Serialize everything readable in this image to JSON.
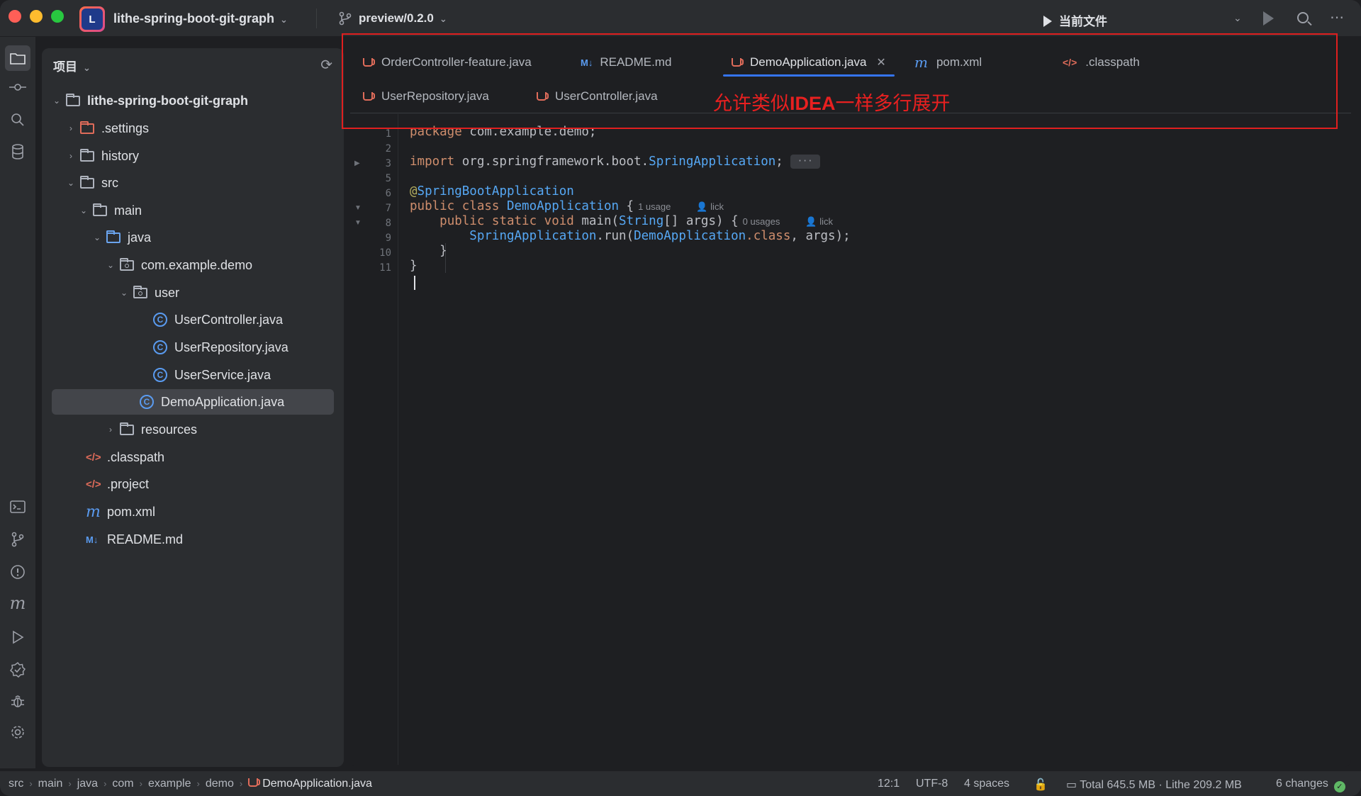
{
  "titlebar": {
    "project_name": "lithe-spring-boot-git-graph",
    "branch": "preview/0.2.0",
    "run_config": "当前文件"
  },
  "project_panel": {
    "title": "项目",
    "tree": [
      {
        "label": "lithe-spring-boot-git-graph",
        "bold": true
      },
      {
        "label": ".settings"
      },
      {
        "label": "history"
      },
      {
        "label": "src"
      },
      {
        "label": "main"
      },
      {
        "label": "java"
      },
      {
        "label": "com.example.demo"
      },
      {
        "label": "user"
      },
      {
        "label": "UserController.java"
      },
      {
        "label": "UserRepository.java"
      },
      {
        "label": "UserService.java"
      },
      {
        "label": "DemoApplication.java",
        "selected": true
      },
      {
        "label": "resources"
      },
      {
        "label": ".classpath"
      },
      {
        "label": ".project"
      },
      {
        "label": "pom.xml"
      },
      {
        "label": "README.md"
      }
    ]
  },
  "tabs": [
    {
      "label": "OrderController-feature.java",
      "icon": "java-file-icon"
    },
    {
      "label": "README.md",
      "icon": "markdown-icon",
      "icon_text": "M↓"
    },
    {
      "label": "DemoApplication.java",
      "icon": "java-file-icon",
      "active": true
    },
    {
      "label": "pom.xml",
      "icon": "maven-icon",
      "icon_text": "m"
    },
    {
      "label": ".classpath",
      "icon": "xml-icon",
      "icon_text": "</>"
    },
    {
      "label": "UserRepository.java",
      "icon": "java-file-icon"
    },
    {
      "label": "UserController.java",
      "icon": "java-file-icon"
    }
  ],
  "annotation": {
    "prefix": "允许类似",
    "highlight": "IDEA",
    "suffix": "一样多行展开",
    "color": "#e01f1f"
  },
  "editor": {
    "line_numbers": [
      "1",
      "2",
      "3",
      "5",
      "6",
      "7",
      "8",
      "9",
      "10",
      "11"
    ],
    "code": {
      "l1_kw": "package",
      "l1_rest": " com.example.demo;",
      "l3_kw": "import",
      "l3_pkg": " org.springframework.boot.",
      "l3_cls": "SpringApplication",
      "l3_end": ";",
      "l3_fold": "···",
      "l6_at": "@",
      "l6_ann": "SpringBootApplication",
      "l7_kw": "public class",
      "l7_cls": " DemoApplication",
      "l7_end": " {",
      "l7_hint": "1 usage",
      "l7_user": "lick",
      "l8_kw": "public static void",
      "l8_mid": " main(",
      "l8_type": "String",
      "l8_end": "[] args) {",
      "l8_hint": "0 usages",
      "l8_user": "lick",
      "l9_cls": "SpringApplication",
      "l9_mid": ".run(",
      "l9_cls2": "DemoApplication",
      "l9_kw": ".class",
      "l9_end": ", args);",
      "l10": "}",
      "l11": "}"
    }
  },
  "statusbar": {
    "breadcrumb": [
      "src",
      "main",
      "java",
      "com",
      "example",
      "demo",
      "DemoApplication.java"
    ],
    "position": "12:1",
    "encoding": "UTF-8",
    "indent": "4 spaces",
    "memory": "Total 645.5 MB · Lithe 209.2 MB",
    "changes": "6 changes"
  },
  "colors": {
    "accent": "#3574f0",
    "background": "#1e1f22",
    "panel": "#2b2d30",
    "keyword": "#cf8e6d",
    "type": "#56a8f5"
  }
}
